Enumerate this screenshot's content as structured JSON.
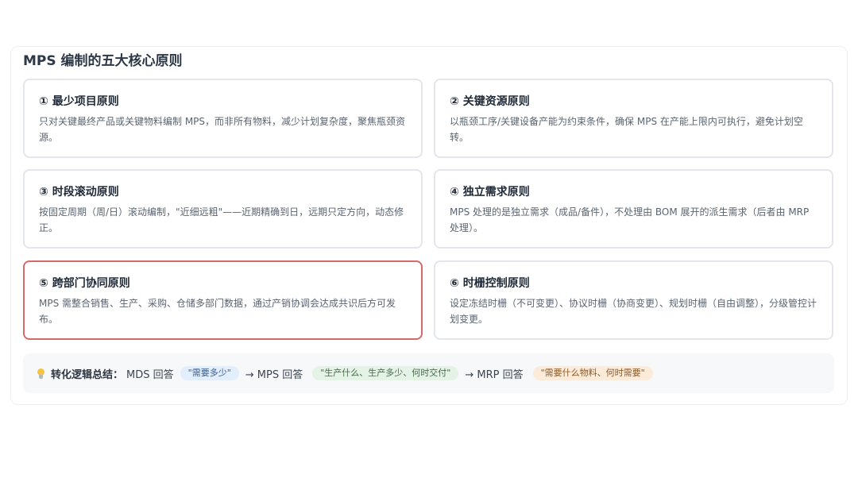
{
  "panel": {
    "title": "MPS 编制的五大核心原则"
  },
  "cards": [
    {
      "title": "① 最少项目原则",
      "desc": "只对关键最终产品或关键物料编制 MPS，而非所有物料，减少计划复杂度，聚焦瓶颈资源。"
    },
    {
      "title": "② 关键资源原则",
      "desc": "以瓶颈工序/关键设备产能为约束条件，确保 MPS 在产能上限内可执行，避免计划空转。"
    },
    {
      "title": "③ 时段滚动原则",
      "desc": "按固定周期（周/日）滚动编制，\"近细远粗\"——近期精确到日，远期只定方向，动态修正。"
    },
    {
      "title": "④ 独立需求原则",
      "desc": "MPS 处理的是独立需求（成品/备件），不处理由 BOM 展开的派生需求（后者由 MRP 处理）。"
    },
    {
      "title": "⑤ 跨部门协同原则",
      "desc": "MPS 需整合销售、生产、采购、仓储多部门数据，通过产销协调会达成共识后方可发布。"
    },
    {
      "title": "⑥ 时栅控制原则",
      "desc": "设定冻结时栅（不可变更）、协议时栅（协商变更）、规划时栅（自由调整），分级管控计划变更。"
    }
  ],
  "summary": {
    "label": "转化逻辑总结：",
    "mds": "MDS 回答",
    "mds_pill": "\"需要多少\"",
    "arrow1": "→ MPS 回答",
    "mps_pill": "\"生产什么、生产多少、何时交付\"",
    "arrow2": "→ MRP 回答",
    "mrp_pill": "\"需要什么物料、何时需要\""
  },
  "colors": {
    "active_border": "#d46a6a",
    "pill_blue": "#e3eefc",
    "pill_green": "#e5f2e6",
    "pill_orange": "#fcebd9"
  },
  "icons": {
    "summary_icon": "lightbulb-icon"
  }
}
